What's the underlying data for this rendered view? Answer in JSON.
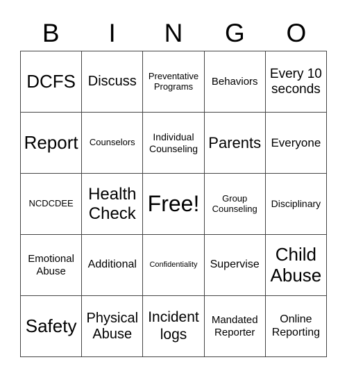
{
  "header": [
    "B",
    "I",
    "N",
    "G",
    "O"
  ],
  "cells": [
    "DCFS",
    "Discuss",
    "Preventative Programs",
    "Behaviors",
    "Every 10 seconds",
    "Report",
    "Counselors",
    "Individual Counseling",
    "Parents",
    "Everyone",
    "NCDCDEE",
    "Health Check",
    "Free!",
    "Group Counseling",
    "Disciplinary",
    "Emotional Abuse",
    "Additional",
    "Confidentiality",
    "Supervise",
    "Child Abuse",
    "Safety",
    "Physical Abuse",
    "Incident logs",
    "Mandated Reporter",
    "Online Reporting"
  ]
}
